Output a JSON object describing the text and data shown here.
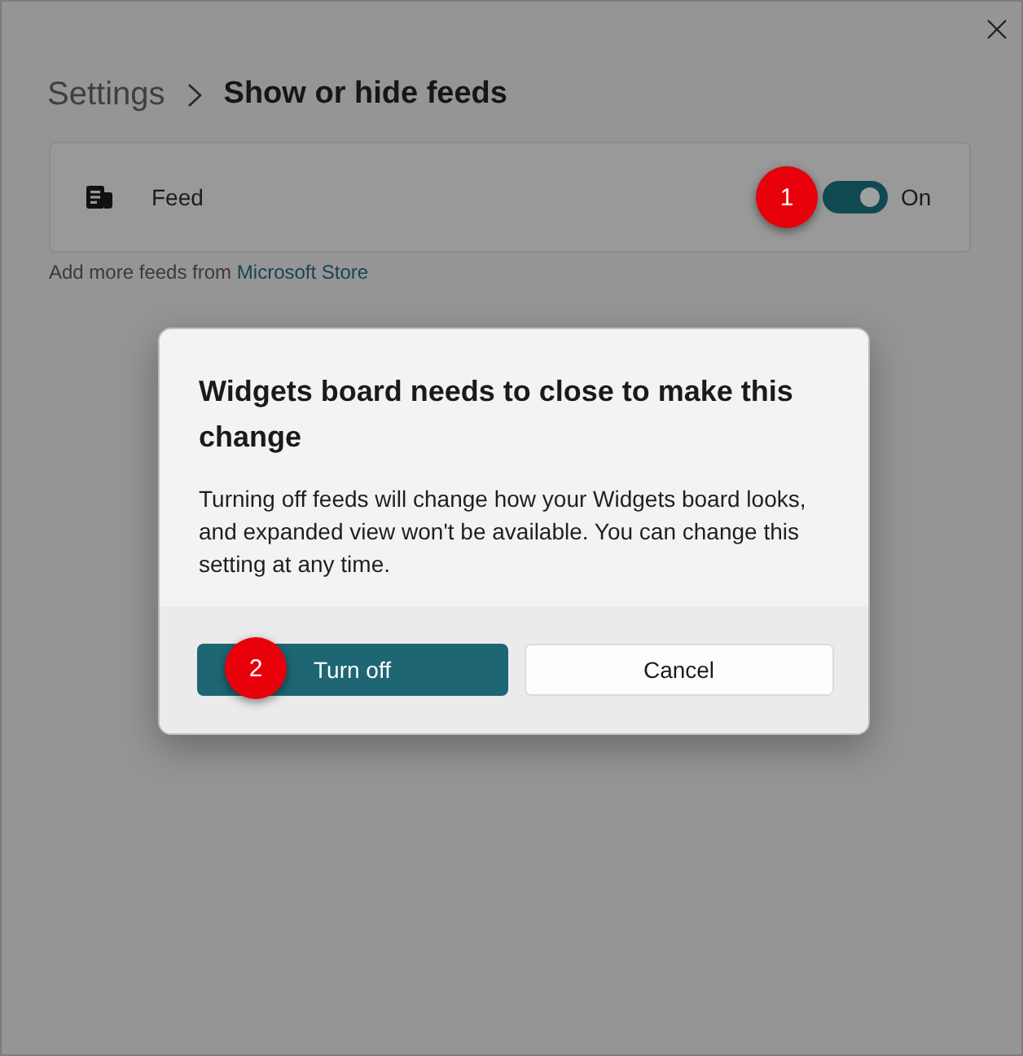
{
  "breadcrumb": [
    {
      "label": "Settings",
      "current": false
    },
    {
      "label": "Show or hide feeds",
      "current": true
    }
  ],
  "feed_setting": {
    "label": "Feed",
    "toggle": {
      "on": true,
      "label": "On"
    }
  },
  "store_hint": {
    "text": "Add more feeds from",
    "link": "Microsoft Store"
  },
  "dialog": {
    "title": "Widgets board needs to close to make this change",
    "body": "Turning off feeds will change how your Widgets board looks, and expanded view won't be available. You can change this setting at any time.",
    "buttons": [
      {
        "label": "Turn off",
        "kind": "primary"
      },
      {
        "label": "Cancel",
        "kind": "secondary"
      }
    ]
  },
  "annotations": [
    {
      "label": "1"
    },
    {
      "label": "2"
    }
  ]
}
